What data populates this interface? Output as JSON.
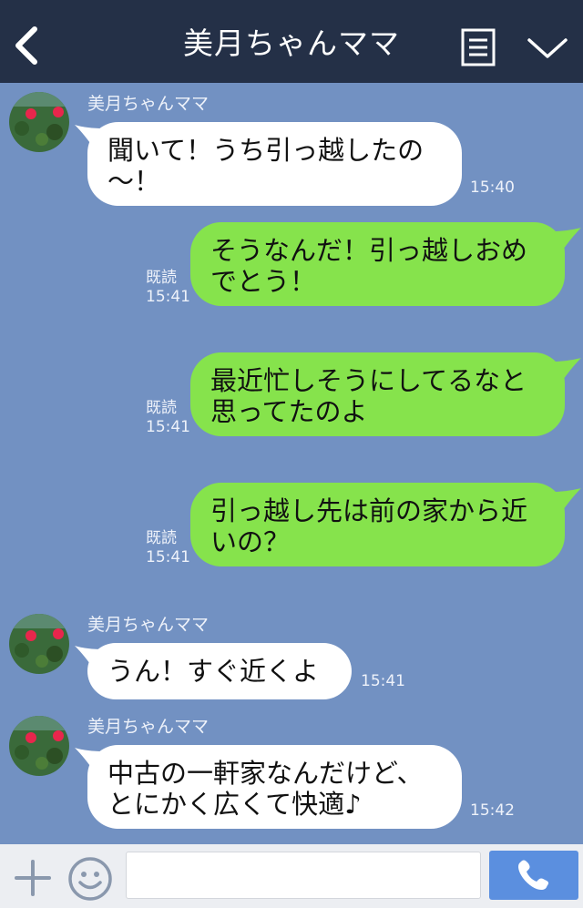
{
  "header": {
    "title": "美月ちゃんママ"
  },
  "messages": [
    {
      "sender": "美月ちゃんママ",
      "text": "聞いて！うち引っ越したの\n〜！",
      "time": "15:40"
    },
    {
      "text": "そうなんだ！引っ越しおめ\nでとう！",
      "read": "既読",
      "time": "15:41"
    },
    {
      "text": "最近忙しそうにしてるなと\n思ってたのよ",
      "read": "既読",
      "time": "15:41"
    },
    {
      "text": "引っ越し先は前の家から近\nいの？",
      "read": "既読",
      "time": "15:41"
    },
    {
      "sender": "美月ちゃんママ",
      "text": "うん！すぐ近くよ",
      "time": "15:41"
    },
    {
      "sender": "美月ちゃんママ",
      "text": "中古の一軒家なんだけど、\nとにかく広くて快適♪",
      "time": "15:42"
    }
  ],
  "footer": {
    "input_value": ""
  },
  "colors": {
    "background": "#7291c2",
    "header": "#243047",
    "bubble_in": "#ffffff",
    "bubble_out": "#86e34c",
    "send_button": "#5b8fdf"
  },
  "icons": {
    "back": "chevron-left-icon",
    "menu": "list-icon",
    "collapse": "chevron-down-icon",
    "add": "plus-icon",
    "emoji": "smile-icon",
    "call": "phone-icon"
  }
}
